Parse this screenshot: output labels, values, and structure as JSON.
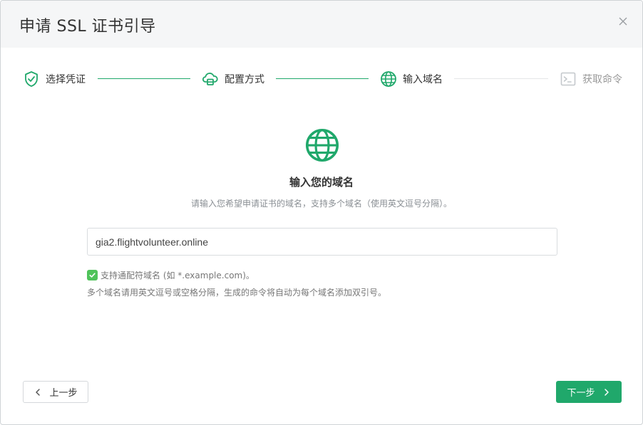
{
  "dialog": {
    "title": "申请 SSL 证书引导"
  },
  "steps": [
    {
      "label": "选择凭证",
      "icon": "shield-check-icon",
      "state": "done"
    },
    {
      "label": "配置方式",
      "icon": "cloud-server-icon",
      "state": "done"
    },
    {
      "label": "输入域名",
      "icon": "globe-icon",
      "state": "active"
    },
    {
      "label": "获取命令",
      "icon": "terminal-icon",
      "state": "pending"
    }
  ],
  "main": {
    "heading": "输入您的域名",
    "description": "请输入您希望申请证书的域名，支持多个域名（使用英文逗号分隔）。",
    "domain_value": "gia2.flightvolunteer.online",
    "tip_wildcard": "支持通配符域名 (如 *.example.com)。",
    "tip_multiple": "多个域名请用英文逗号或空格分隔，生成的命令将自动为每个域名添加双引号。"
  },
  "footer": {
    "prev_label": "上一步",
    "next_label": "下一步"
  },
  "colors": {
    "accent": "#20a86b",
    "pending": "#c4c8cc",
    "header_bg": "#f5f6f7"
  }
}
